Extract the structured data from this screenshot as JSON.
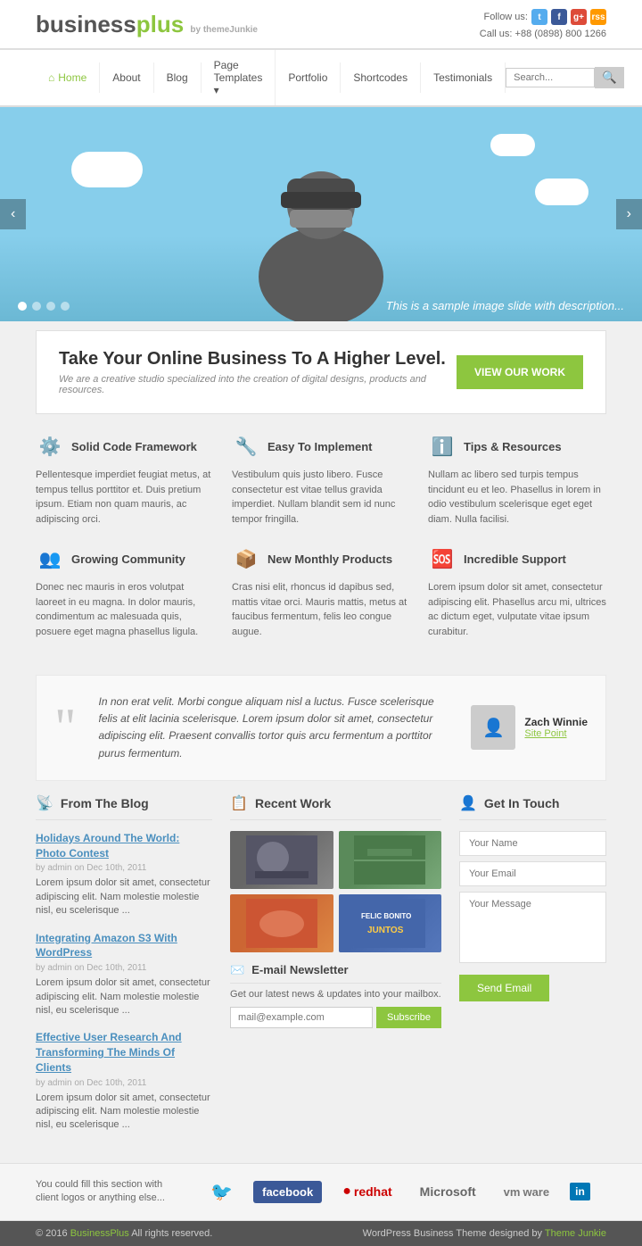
{
  "header": {
    "logo_business": "business",
    "logo_plus": "plus",
    "logo_by": "by themeJunkie",
    "follow_label": "Follow us:",
    "call_label": "Call us:",
    "phone": "+88 (0898) 800 1266"
  },
  "nav": {
    "items": [
      {
        "label": "Home",
        "active": true
      },
      {
        "label": "About"
      },
      {
        "label": "Blog"
      },
      {
        "label": "Page Templates ▾"
      },
      {
        "label": "Portfolio"
      },
      {
        "label": "Shortcodes"
      },
      {
        "label": "Testimonials"
      }
    ],
    "search_placeholder": "Search..."
  },
  "slider": {
    "caption": "This is a sample image slide with description...",
    "prev_label": "‹",
    "next_label": "›"
  },
  "cta": {
    "heading": "Take Your Online Business To A Higher Level.",
    "subtext": "We are a creative studio specialized into the creation of digital designs, products and resources.",
    "button_label": "VIEW OUR WORK"
  },
  "features": {
    "row1": [
      {
        "icon": "⚙",
        "title": "Solid Code Framework",
        "body": "Pellentesque imperdiet feugiat metus, at tempus tellus porttitor et. Duis pretium ipsum. Etiam non quam mauris, ac adipiscing orci."
      },
      {
        "icon": "🔧",
        "title": "Easy To Implement",
        "body": "Vestibulum quis justo libero. Fusce consectetur est vitae tellus gravida imperdiet. Nullam blandit sem id nunc tempor fringilla."
      },
      {
        "icon": "ℹ",
        "title": "Tips & Resources",
        "body": "Nullam ac libero sed turpis tempus tincidunt eu et leo. Phasellus in lorem in odio vestibulum scelerisque eget eget diam. Nulla facilisi."
      }
    ],
    "row2": [
      {
        "icon": "👥",
        "title": "Growing Community",
        "body": "Donec nec mauris in eros volutpat laoreet in eu magna. In dolor mauris, condimentum ac malesuada quis, posuere eget magna phasellus ligula."
      },
      {
        "icon": "📦",
        "title": "New Monthly Products",
        "body": "Cras nisi elit, rhoncus id dapibus sed, mattis vitae orci. Mauris mattis, metus at faucibus fermentum, felis leo congue augue."
      },
      {
        "icon": "🆘",
        "title": "Incredible Support",
        "body": "Lorem ipsum dolor sit amet, consectetur adipiscing elit. Phasellus arcu mi, ultrices ac dictum eget, vulputate vitae ipsum curabitur."
      }
    ]
  },
  "testimonial": {
    "text": "In non erat velit. Morbi congue aliquam nisl a luctus. Fusce scelerisque felis at elit lacinia scelerisque. Lorem ipsum dolor sit amet, consectetur adipiscing elit. Praesent convallis tortor quis arcu fermentum a porttitor purus fermentum.",
    "author_name": "Zach Winnie",
    "author_site": "Site Point"
  },
  "blog": {
    "section_title": "From The Blog",
    "posts": [
      {
        "title": "Holidays Around The World: Photo Contest",
        "meta": "by admin on Dec 10th, 2011",
        "excerpt": "Lorem ipsum dolor sit amet, consectetur adipiscing elit. Nam molestie molestie nisl, eu scelerisque ..."
      },
      {
        "title": "Integrating Amazon S3 With WordPress",
        "meta": "by admin on Dec 10th, 2011",
        "excerpt": "Lorem ipsum dolor sit amet, consectetur adipiscing elit. Nam molestie molestie nisl, eu scelerisque ..."
      },
      {
        "title": "Effective User Research And Transforming The Minds Of Clients",
        "meta": "by admin on Dec 10th, 2011",
        "excerpt": "Lorem ipsum dolor sit amet, consectetur adipiscing elit. Nam molestie molestie nisl, eu scelerisque ..."
      }
    ]
  },
  "recent_work": {
    "section_title": "Recent Work"
  },
  "newsletter": {
    "title": "E-mail Newsletter",
    "description": "Get our latest news & updates into your mailbox.",
    "input_placeholder": "mail@example.com",
    "button_label": "Subscribe"
  },
  "contact": {
    "section_title": "Get In Touch",
    "name_placeholder": "Your Name",
    "email_placeholder": "Your Email",
    "message_placeholder": "Your Message",
    "button_label": "Send Email"
  },
  "logos_bar": {
    "text": "You could fill this section with client logos or anything else...",
    "brands": [
      "twitter",
      "facebook",
      "redhat",
      "Microsoft",
      "vmware",
      "LinkedIn"
    ]
  },
  "footer": {
    "copyright": "© 2016",
    "site_name": "BusinessPlus",
    "rights": "All rights reserved.",
    "theme_label": "WordPress Business Theme designed by",
    "theme_author": "Theme Junkie"
  }
}
